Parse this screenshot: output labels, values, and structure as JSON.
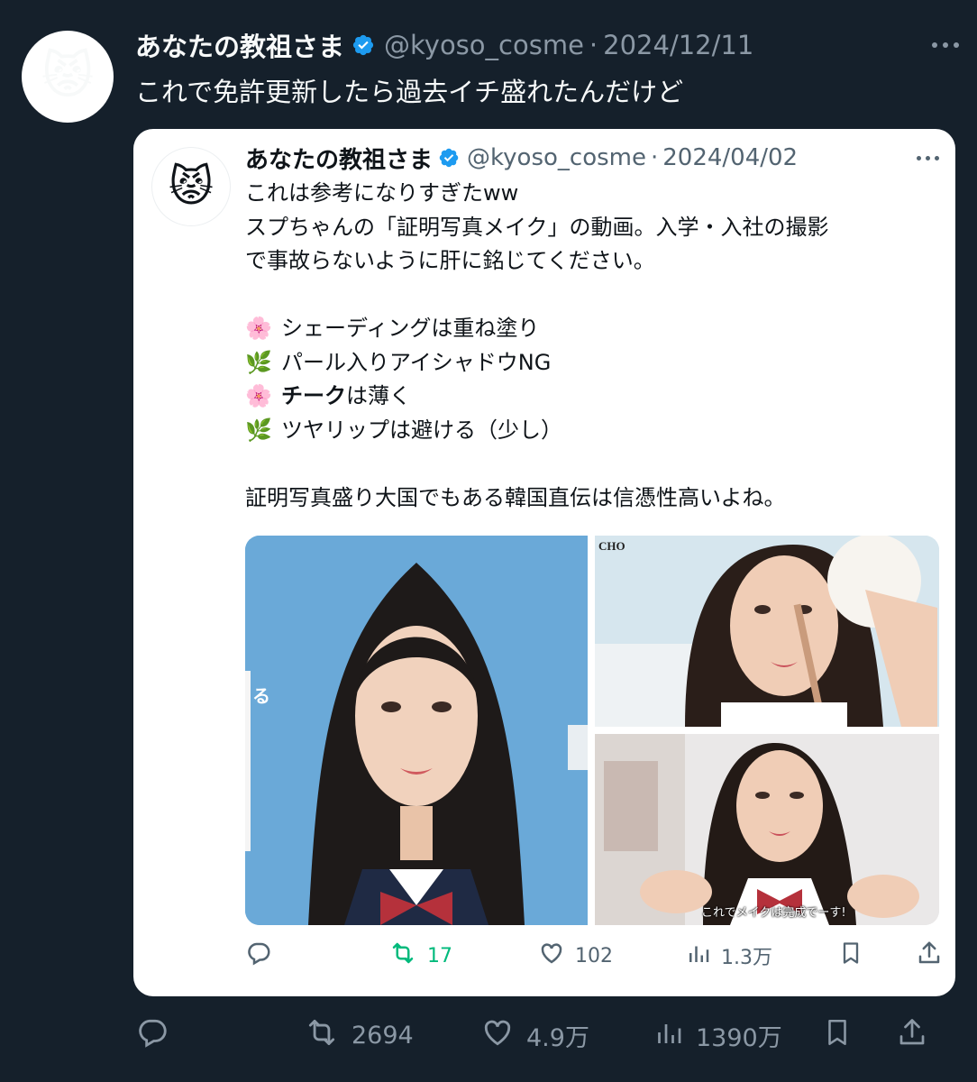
{
  "tweet": {
    "avatar_emoji": "😾",
    "author_name": "あなたの教祖さま",
    "handle": "@kyoso_cosme",
    "separator": "·",
    "date": "2024/12/11",
    "text": "これで免許更新したら過去イチ盛れたんだけど",
    "actions": {
      "reply": "",
      "retweet": "2694",
      "like": "4.9万",
      "views": "1390万"
    }
  },
  "quoted": {
    "avatar_emoji": "😾",
    "author_name": "あなたの教祖さま",
    "handle": "@kyoso_cosme",
    "separator": "·",
    "date": "2024/04/02",
    "lines": {
      "l1": "これは参考になりすぎたww",
      "l2": "スプちゃんの「証明写真メイク」の動画。入学・入社の撮影",
      "l3": "で事故らないように肝に銘じてください。",
      "b1_emoji": "🌸",
      "b1": "シェーディングは重ね塗り",
      "b2_emoji": "🌿",
      "b2": "パール入りアイシャドウNG",
      "b3_emoji": "🌸",
      "b3_bold": "チーク",
      "b3_rest": "は薄く",
      "b4_emoji": "🌿",
      "b4": "ツヤリップは避ける（少し）",
      "l4": "証明写真盛り大国でもある韓国直伝は信憑性高いよね。"
    },
    "media": {
      "main_side_text": "る",
      "top_brand": "CHO",
      "bottom_caption": "これでメイクは完成でーす!"
    },
    "actions": {
      "retweet": "17",
      "like": "102",
      "views": "1.3万"
    }
  },
  "colors": {
    "background": "#15202b",
    "card": "#ffffff",
    "verified": "#1d9bf0",
    "retweet_active": "#00ba7c",
    "muted_dark": "#8b98a5",
    "muted_light": "#536471"
  }
}
